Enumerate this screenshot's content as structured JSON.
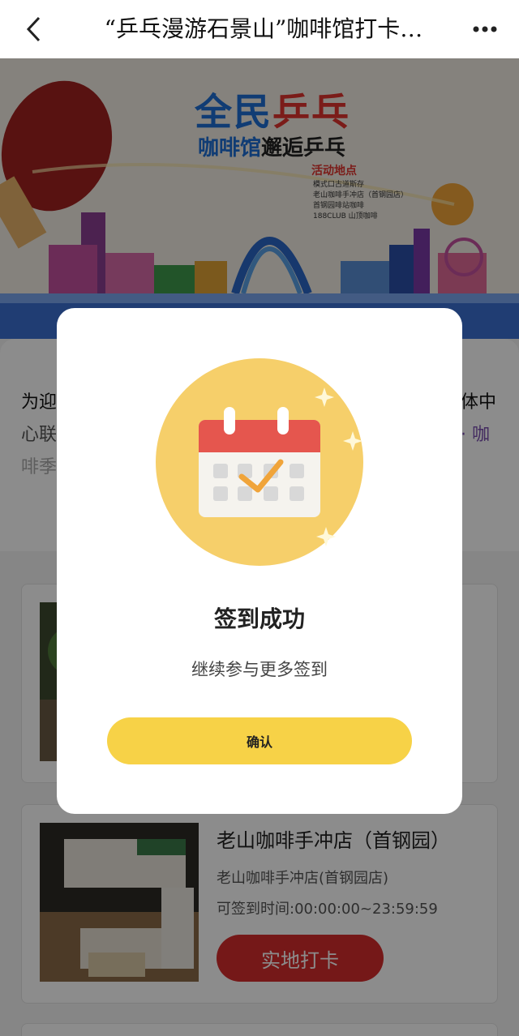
{
  "header": {
    "title": "“乒乓漫游石景山”咖啡馆打卡…",
    "back_icon": "chevron-left-icon",
    "more_icon": "more-horizontal-icon"
  },
  "banner": {
    "title_blue": "全民",
    "title_red": "乒乓",
    "subtitle_blue": "咖啡馆",
    "subtitle_dark": "邂逅乒乓",
    "location_heading": "活动地点",
    "locations": [
      "模式口古道斯存",
      "老山咖啡手冲店（首钢园店）",
      "首钢园啡站咖啡",
      "188CLUB 山顶咖啡"
    ]
  },
  "intro": {
    "line1_start": "为迎",
    "line1_end": "体中",
    "line2_start": "心联",
    "line2_end": "· 咖",
    "line3_start": "啡季"
  },
  "stores": [
    {
      "name": "",
      "address": "",
      "time": "",
      "button": ""
    },
    {
      "name": "老山咖啡手冲店（首钢园）",
      "address": "老山咖啡手冲店(首钢园店)",
      "time": "可签到时间:00:00:00~23:59:59",
      "button": "实地打卡"
    }
  ],
  "modal": {
    "icon": "calendar-check-icon",
    "title": "签到成功",
    "subtitle": "继续参与更多签到",
    "confirm_label": "确认"
  },
  "colors": {
    "accent_yellow": "#f7d247",
    "checkin_red": "#d62c2c",
    "calendar_red": "#e5564e",
    "brand_blue": "#1e6ed4"
  }
}
